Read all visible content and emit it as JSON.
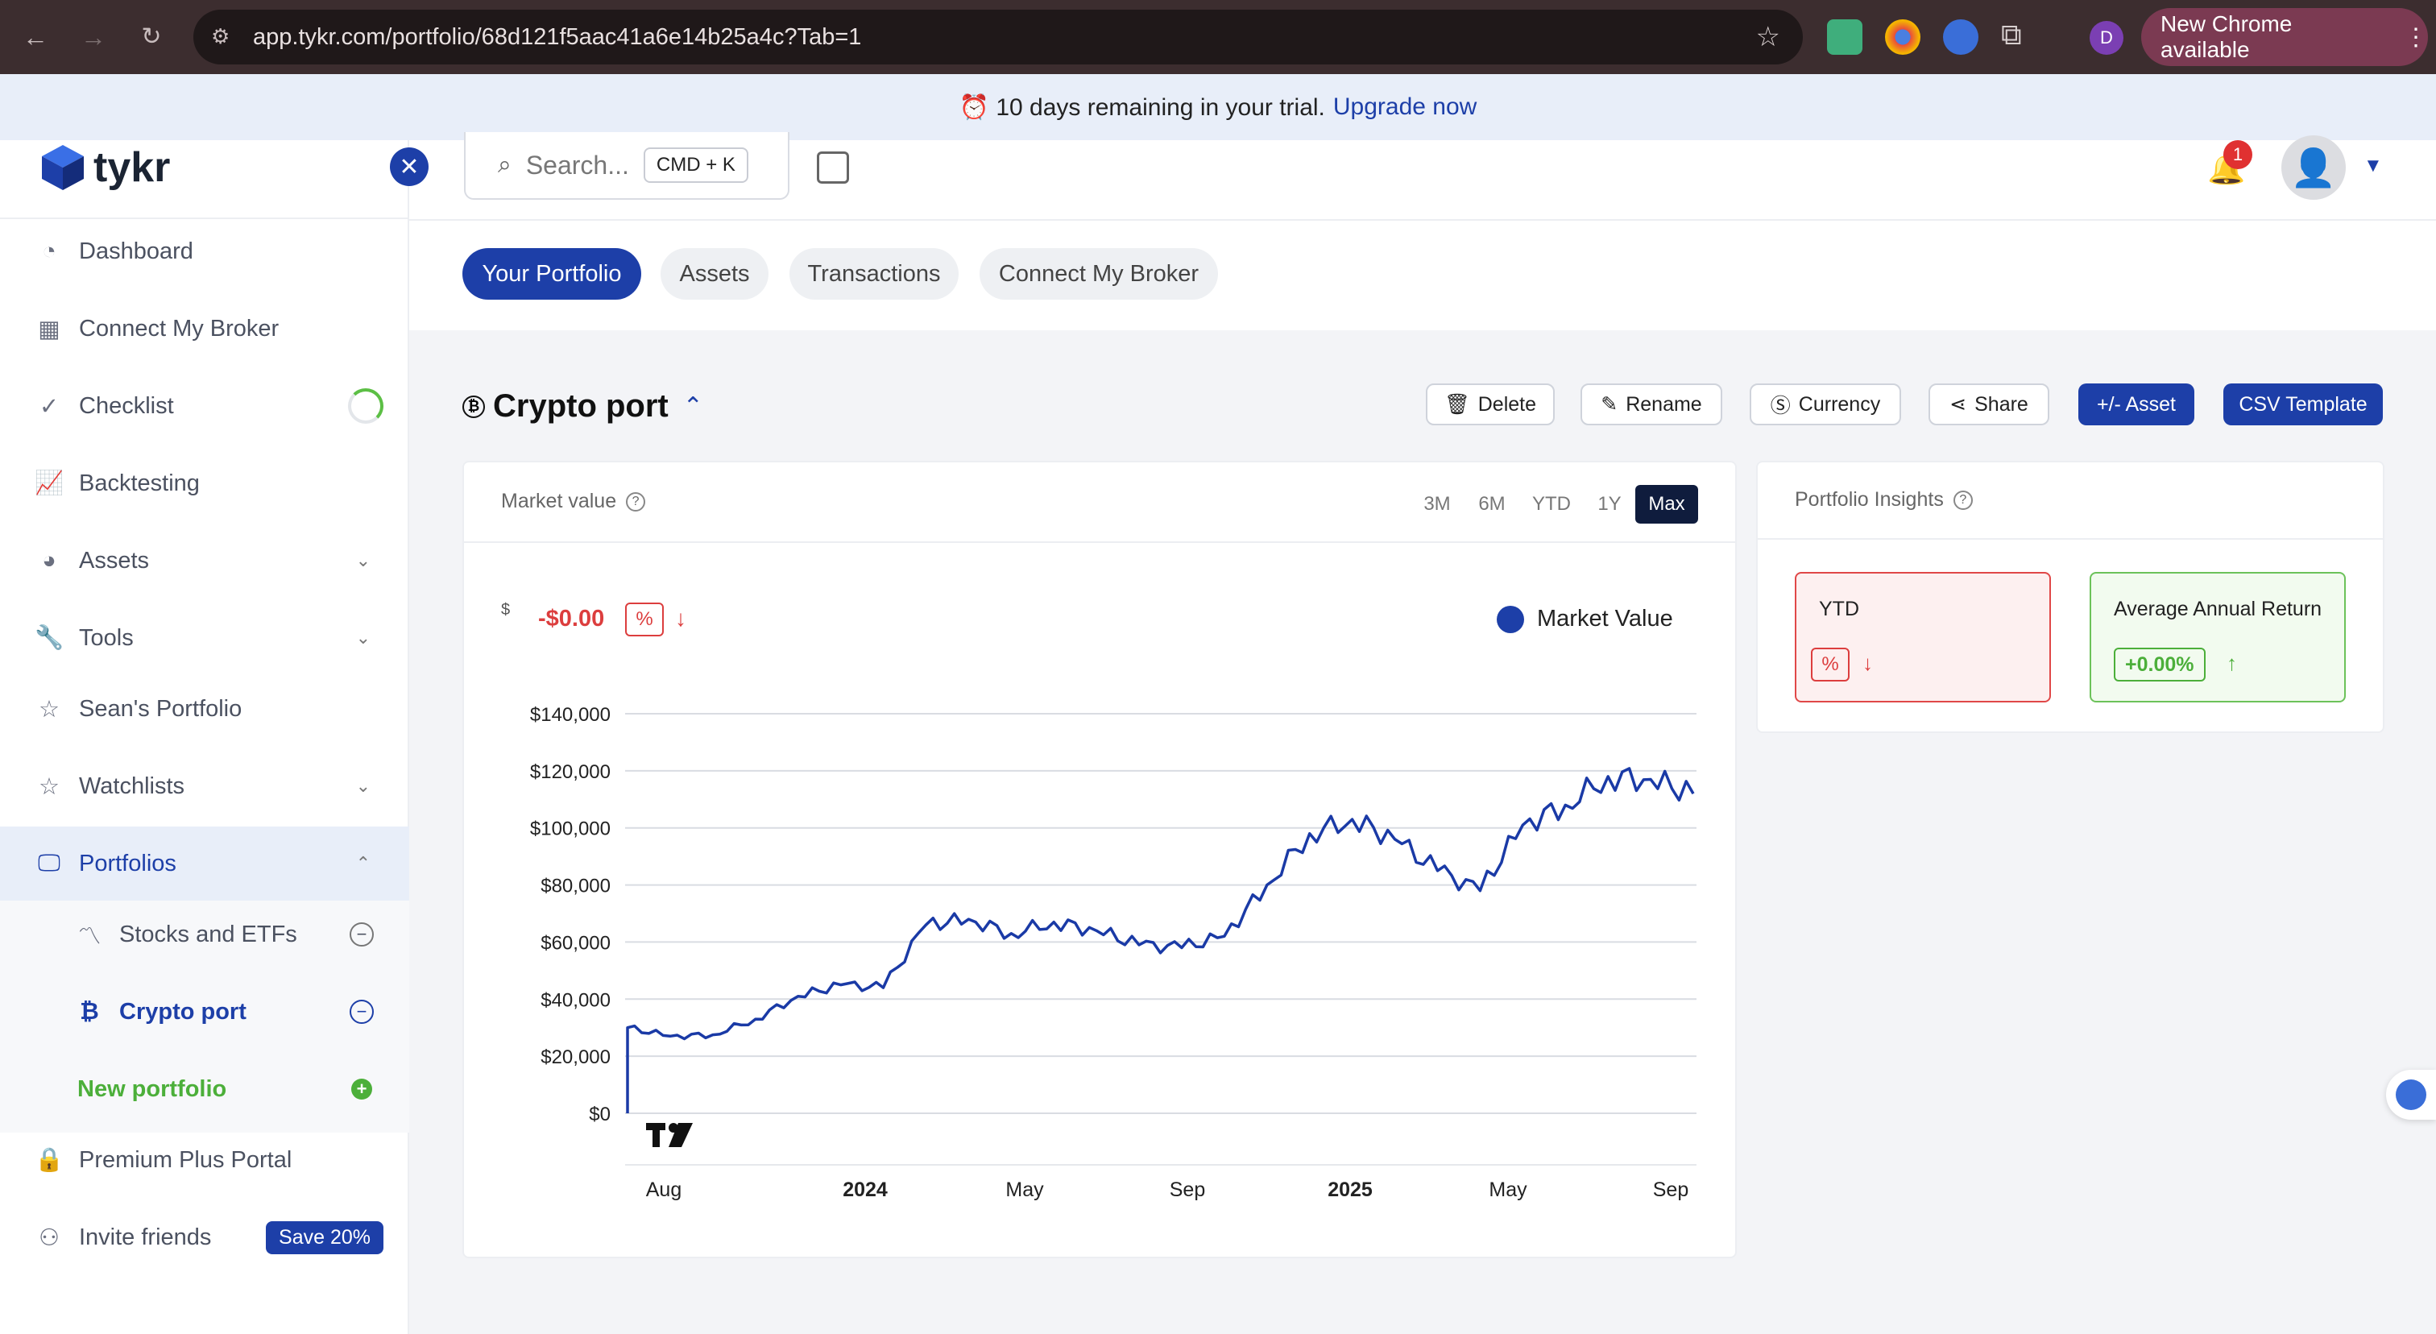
{
  "browser": {
    "url": "app.tykr.com/portfolio/68d121f5aac41a6e14b25a4c?Tab=1",
    "new_chrome": "New Chrome available",
    "profile_initial": "D"
  },
  "trial": {
    "message": "⏰ 10 days remaining in your trial.",
    "link": "Upgrade now"
  },
  "brand": {
    "name": "tykr"
  },
  "search": {
    "placeholder": "Search...",
    "shortcut": "CMD + K"
  },
  "notifications": {
    "count": "1"
  },
  "sidebar": {
    "items": [
      {
        "label": "Dashboard"
      },
      {
        "label": "Connect My Broker"
      },
      {
        "label": "Checklist"
      },
      {
        "label": "Backtesting"
      },
      {
        "label": "Assets"
      },
      {
        "label": "Tools"
      },
      {
        "label": "Sean's Portfolio"
      },
      {
        "label": "Watchlists"
      },
      {
        "label": "Portfolios"
      },
      {
        "label": "Stocks and ETFs"
      },
      {
        "label": "Crypto port"
      },
      {
        "label": "New portfolio"
      },
      {
        "label": "Premium Plus Portal"
      },
      {
        "label": "Invite friends"
      }
    ],
    "invite_badge": "Save 20%"
  },
  "tabs": [
    {
      "label": "Your Portfolio",
      "active": true
    },
    {
      "label": "Assets"
    },
    {
      "label": "Transactions"
    },
    {
      "label": "Connect My Broker"
    }
  ],
  "portfolio": {
    "title": "Crypto port",
    "actions": {
      "delete": "Delete",
      "rename": "Rename",
      "currency": "Currency",
      "share": "Share",
      "add_asset": "+/- Asset",
      "csv": "CSV Template"
    }
  },
  "market": {
    "header": "Market value",
    "ranges": [
      "3M",
      "6M",
      "YTD",
      "1Y",
      "Max"
    ],
    "selected_range": "Max",
    "currency_symbol": "$",
    "change_value": "-$0.00",
    "change_pct": "%",
    "legend": "Market Value"
  },
  "insights": {
    "header": "Portfolio Insights",
    "ytd": {
      "label": "YTD",
      "pct": "%"
    },
    "aar": {
      "label": "Average Annual Return",
      "value": "+0.00%"
    }
  },
  "colors": {
    "primary": "#1d3fa8",
    "negative": "#dc3e3e",
    "positive": "#4caf3a",
    "line": "#1a3aa6"
  },
  "chart_data": {
    "type": "line",
    "series": [
      {
        "name": "Market Value"
      }
    ],
    "y_ticks": [
      "$140,000",
      "$120,000",
      "$100,000",
      "$80,000",
      "$60,000",
      "$40,000",
      "$20,000",
      "$0"
    ],
    "x_ticks": [
      "Aug",
      "2024",
      "May",
      "Sep",
      "2025",
      "May",
      "Sep"
    ],
    "ylim": [
      0,
      140000
    ],
    "x": [
      "2023-08",
      "2023-09",
      "2023-10",
      "2023-11",
      "2023-12",
      "2024-01",
      "2024-02",
      "2024-03",
      "2024-04",
      "2024-05",
      "2024-06",
      "2024-07",
      "2024-08",
      "2024-09",
      "2024-10",
      "2024-11",
      "2024-12",
      "2025-01",
      "2025-02",
      "2025-03",
      "2025-04",
      "2025-05",
      "2025-06",
      "2025-07",
      "2025-08",
      "2025-09"
    ],
    "values": [
      30000,
      27000,
      27500,
      33000,
      41000,
      45000,
      44000,
      66000,
      68000,
      63000,
      67000,
      64000,
      59000,
      58000,
      62000,
      80000,
      98000,
      103000,
      96000,
      85000,
      78000,
      101000,
      108000,
      118000,
      117000,
      112000
    ]
  }
}
